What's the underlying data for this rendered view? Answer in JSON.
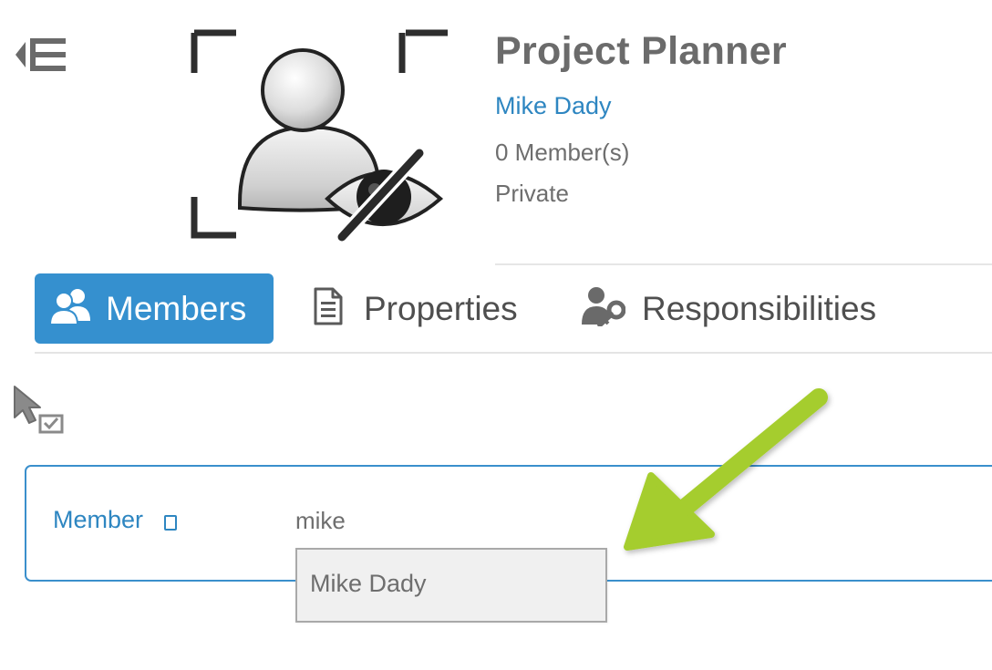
{
  "header": {
    "title": "Project Planner",
    "owner": "Mike Dady",
    "members_count": "0 Member(s)",
    "privacy": "Private",
    "collapse_icon": "collapse-menu-icon",
    "avatar_icon": "private-group-avatar-icon"
  },
  "tabs": [
    {
      "label": "Members",
      "icon": "members-icon",
      "active": true
    },
    {
      "label": "Properties",
      "icon": "document-icon",
      "active": false
    },
    {
      "label": "Responsibilities",
      "icon": "user-key-icon",
      "active": false
    }
  ],
  "toolbar": {
    "select_icon": "select-cursor-icon"
  },
  "member_form": {
    "label": "Member",
    "input_value": "mike",
    "suggestions": [
      "Mike Dady"
    ]
  },
  "annotation": {
    "arrow_icon": "green-arrow-icon"
  },
  "colors": {
    "accent": "#3590cf",
    "link": "#2e86c1",
    "text": "#6e6e6e",
    "title": "#6b6b6b",
    "annotation_arrow": "#a5cd2e",
    "suggestion_bg": "#f0f0f0"
  }
}
